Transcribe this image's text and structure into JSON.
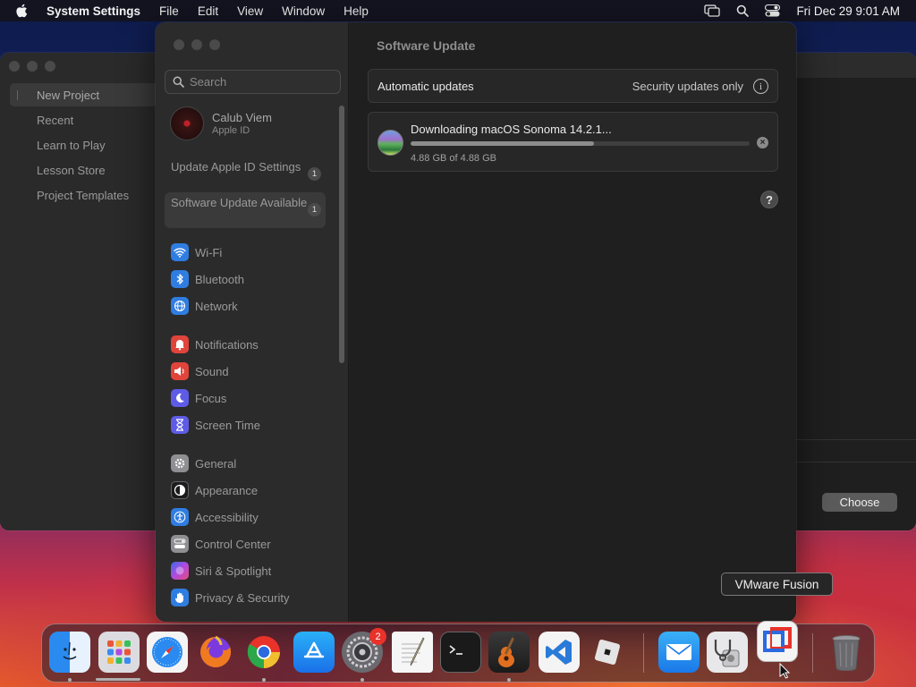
{
  "menubar": {
    "app_name": "System Settings",
    "menus": [
      "File",
      "Edit",
      "View",
      "Window",
      "Help"
    ],
    "clock": "Fri Dec 29  9:01 AM",
    "icons": [
      "apple-icon",
      "screen-mirroring-icon",
      "spotlight-search-icon",
      "control-center-icon"
    ]
  },
  "background_window": {
    "sidebar_items": [
      "New Project",
      "Recent",
      "Learn to Play",
      "Lesson Store",
      "Project Templates"
    ],
    "selected_item": "New Project",
    "choose_button": "Choose"
  },
  "sidebar": {
    "search_placeholder": "Search",
    "account": {
      "name": "Calub Viem",
      "subtitle": "Apple ID"
    },
    "notices": [
      {
        "label": "Update Apple ID Settings",
        "badge": "1"
      },
      {
        "label": "Software Update Available",
        "badge": "1",
        "selected": true
      }
    ],
    "group1": [
      {
        "label": "Wi-Fi",
        "icon": "wifi-icon",
        "color": "#2f7de1"
      },
      {
        "label": "Bluetooth",
        "icon": "bluetooth-icon",
        "color": "#2f7de1"
      },
      {
        "label": "Network",
        "icon": "globe-icon",
        "color": "#2f7de1"
      }
    ],
    "group2": [
      {
        "label": "Notifications",
        "icon": "bell-icon",
        "color": "#e0443a"
      },
      {
        "label": "Sound",
        "icon": "speaker-icon",
        "color": "#e0443a"
      },
      {
        "label": "Focus",
        "icon": "moon-icon",
        "color": "#5e5ce6"
      },
      {
        "label": "Screen Time",
        "icon": "hourglass-icon",
        "color": "#5e5ce6"
      }
    ],
    "group3": [
      {
        "label": "General",
        "icon": "gear-icon",
        "color": "#8e8e93"
      },
      {
        "label": "Appearance",
        "icon": "appearance-icon",
        "color": "#1c1c1e"
      },
      {
        "label": "Accessibility",
        "icon": "accessibility-icon",
        "color": "#2f7de1"
      },
      {
        "label": "Control Center",
        "icon": "control-center-icon",
        "color": "#8e8e93"
      },
      {
        "label": "Siri & Spotlight",
        "icon": "siri-icon",
        "color": "#b04ae0"
      },
      {
        "label": "Privacy & Security",
        "icon": "hand-icon",
        "color": "#2f7de1"
      }
    ]
  },
  "content": {
    "title": "Software Update",
    "automatic_updates": {
      "label": "Automatic updates",
      "value": "Security updates only"
    },
    "download": {
      "title": "Downloading macOS Sonoma 14.2.1...",
      "size": "4.88 GB of 4.88 GB",
      "progress": 0.54
    }
  },
  "tooltip": "VMware Fusion",
  "dock": {
    "apps": [
      "Finder",
      "Launchpad",
      "Safari",
      "Firefox",
      "Google Chrome",
      "App Store",
      "System Settings",
      "TextEdit",
      "Terminal",
      "GarageBand",
      "Visual Studio Code",
      "Roblox",
      "Mail",
      "Disk Utility",
      "VMware Fusion",
      "Trash"
    ],
    "system_settings_badge": "2"
  }
}
